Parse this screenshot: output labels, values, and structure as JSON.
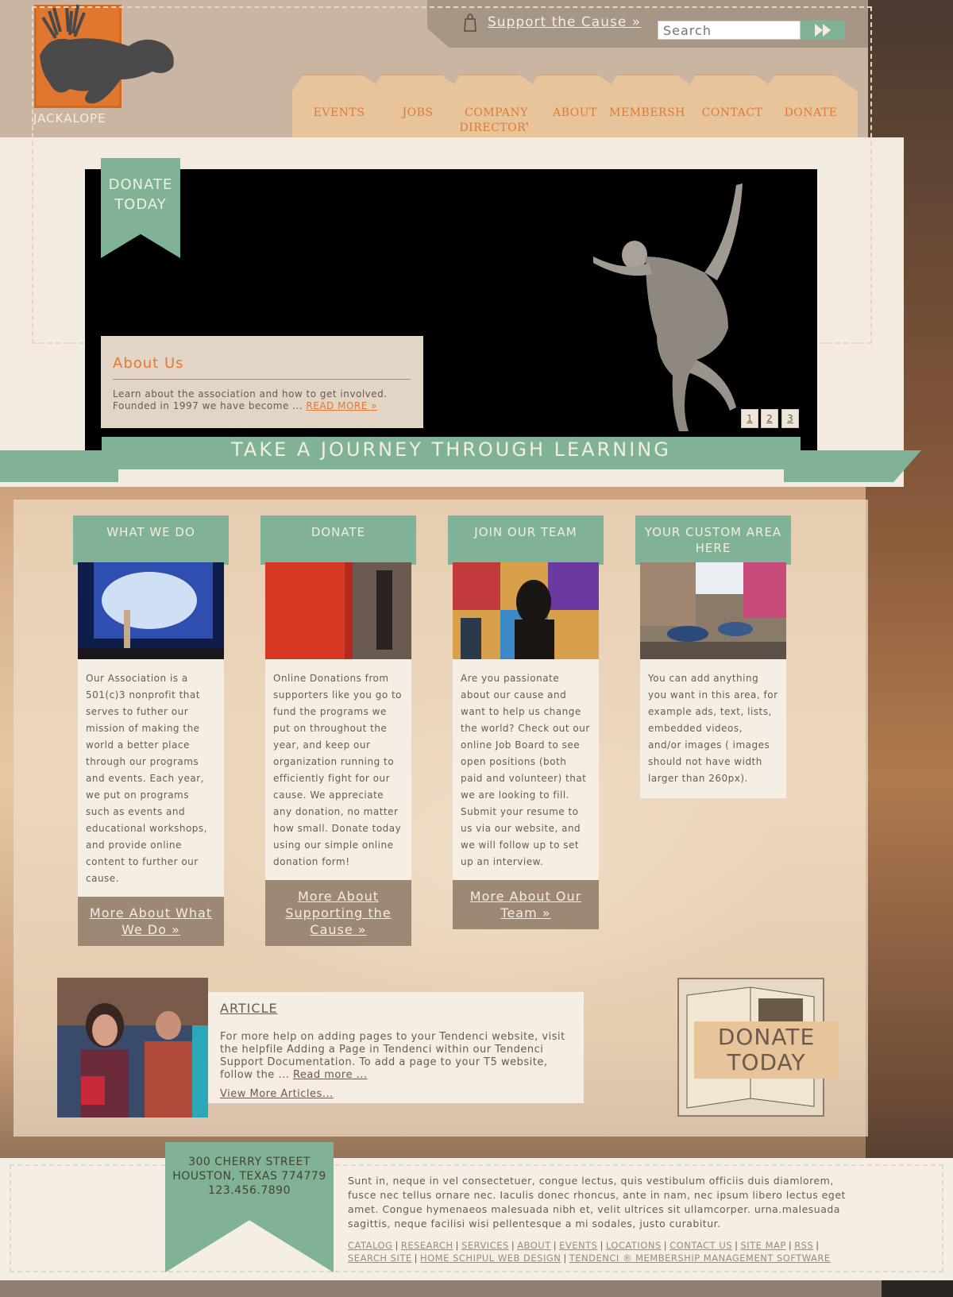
{
  "brand": {
    "name": "JACKALOPE"
  },
  "header": {
    "support_label": "Support the Cause »",
    "search_placeholder": "Search"
  },
  "nav": [
    {
      "label": "EVENTS"
    },
    {
      "label": "JOBS"
    },
    {
      "label": "COMPANY\nDIRECTORY"
    },
    {
      "label": "ABOUT"
    },
    {
      "label": "MEMBERSHIP"
    },
    {
      "label": "CONTACT"
    },
    {
      "label": "DONATE"
    }
  ],
  "slider": {
    "ribbon_label": "DONATE\nTODAY",
    "about_title": "About Us",
    "about_text": "Learn about the association and how to get involved. Founded in 1997 we have become ... ",
    "about_link": "READ MORE »",
    "pages": [
      "1",
      "2",
      "3"
    ],
    "tagline": "TAKE A JOURNEY THROUGH LEARNING"
  },
  "cards": [
    {
      "title": "WHAT WE DO",
      "body": "Our Association is a 501(c)3 nonprofit that serves to futher our mission of making the world a better place through our programs and events. Each year, we put on programs such as events and educational workshops, and provide online content to further our cause.",
      "more": "More About What We Do »"
    },
    {
      "title": "DONATE",
      "body": "Online Donations from supporters like you go to fund the programs we put on throughout the year, and keep our organization running to efficiently fight for our cause. We appreciate any donation, no matter how small. Donate today using our simple online donation form!",
      "more": "More About Supporting the Cause »"
    },
    {
      "title": "JOIN OUR TEAM",
      "body": "Are you passionate about our cause and want to help us change the world? Check out our online Job Board to see open positions (both paid and volunteer) that we are looking to fill. Submit your resume to us via our website, and we will follow up to set up an interview.",
      "more": "More About Our Team »"
    },
    {
      "title": "YOUR CUSTOM AREA HERE",
      "body": "You can add anything you want in this area, for example ads, text, lists, embedded videos, and/or images ( images should not have width larger than 260px).",
      "more": ""
    }
  ],
  "article": {
    "title": "ARTICLE",
    "text": "For more help on adding pages to your Tendenci website, visit the helpfile Adding a Page in Tendenci within our Tendenci Support Documentation. To add a page to your T5 website, follow the ... ",
    "read_more": "Read more ...",
    "view_more": "View More Articles..."
  },
  "donate_card": {
    "label": "DONATE\nTODAY"
  },
  "footer": {
    "address_line1": "300 CHERRY STREET",
    "address_line2": "HOUSTON, TEXAS 774779",
    "phone": "123.456.7890",
    "text": "Sunt in, neque in vel consectetuer, congue lectus, quis vestibulum officiis duis diamlorem, fusce nec tellus ornare nec. Iaculis donec rhoncus, ante in nam, nec ipsum libero lectus eget amet. Congue hymenaeos malesuada nibh et, velit ultrices sit ullamcorper. urna.malesuada sagittis, neque facilisi wisi pellentesque a mi sodales, justo curabitur.",
    "links": [
      "CATALOG",
      "RESEARCH",
      "SERVICES",
      "ABOUT",
      "EVENTS",
      "LOCATIONS",
      "CONTACT US",
      "SITE MAP",
      "RSS",
      "SEARCH SITE",
      "HOME SCHIPUL WEB DESIGN",
      "TENDENCI ® MEMBERSHIP MANAGEMENT SOFTWARE"
    ]
  },
  "colors": {
    "accent": "#e07a36",
    "green": "#7fb297",
    "tan": "#c9b5a2"
  }
}
